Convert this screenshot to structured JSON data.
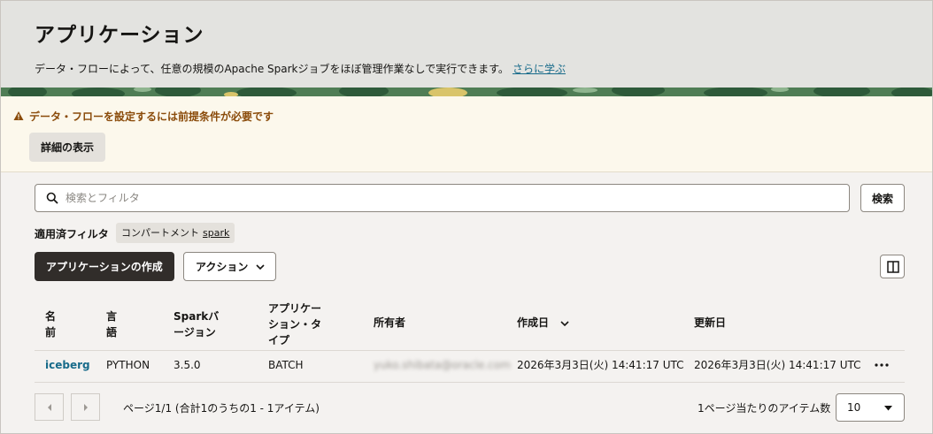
{
  "header": {
    "title": "アプリケーション",
    "description": "データ・フローによって、任意の規模のApache Sparkジョブをほぼ管理作業なしで実行できます。",
    "learn_more": "さらに学ぶ"
  },
  "warning": {
    "message": "データ・フローを設定するには前提条件が必要です",
    "details_button": "詳細の表示",
    "color": "#8a4b0a"
  },
  "search": {
    "placeholder": "検索とフィルタ",
    "button": "検索"
  },
  "filters": {
    "label": "適用済フィルタ",
    "chip_key": "コンパートメント",
    "chip_value": "spark"
  },
  "toolbar": {
    "create_button": "アプリケーションの作成",
    "actions_button": "アクション"
  },
  "table": {
    "headers": {
      "name": [
        "名",
        "前"
      ],
      "language": [
        "言",
        "語"
      ],
      "spark_version": [
        "Sparkバ",
        "ージョン"
      ],
      "app_type": [
        "アプリケー",
        "ション・タ",
        "イプ"
      ],
      "owner": "所有者",
      "created": "作成日",
      "updated": "更新日"
    },
    "rows": [
      {
        "name": "iceberg",
        "language": "PYTHON",
        "spark_version": "3.5.0",
        "app_type": "BATCH",
        "owner": "yuko.shibata@oracle.com",
        "created": "2026年3月3日(火) 14:41:17 UTC",
        "updated": "2026年3月3日(火) 14:41:17 UTC"
      }
    ]
  },
  "pagination": {
    "summary": "ページ1/1 (合計1のうちの1 - 1アイテム)",
    "per_page_label": "1ページ当たりのアイテム数",
    "per_page_value": "10"
  },
  "colors": {
    "primary_button": "#312d2a",
    "link": "#186b8a",
    "warning_bg": "#fcf8ec"
  }
}
